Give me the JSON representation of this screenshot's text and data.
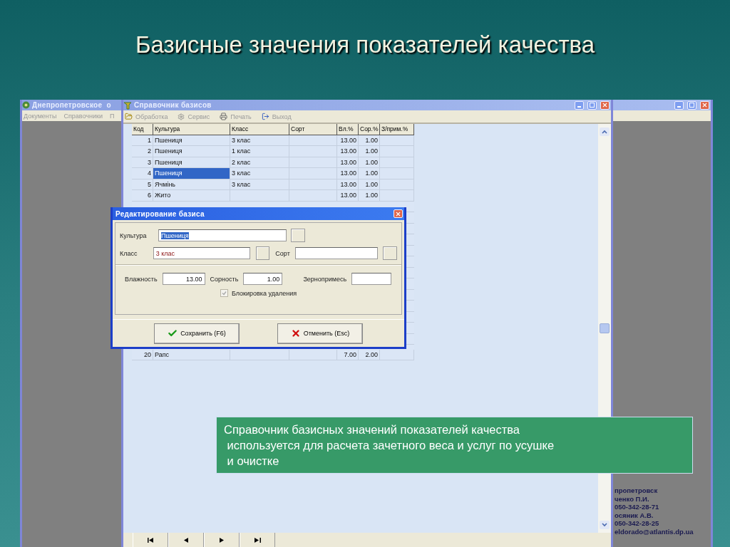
{
  "slide": {
    "title": "Базисные значения показателей качества"
  },
  "main_window": {
    "title": "Днепропетровское  о",
    "menu": [
      "Документы",
      "Справочники",
      "П"
    ],
    "info_lines": [
      "пропетровск",
      "ченко П.И.",
      "050-342-28-71",
      "осяник А.В.",
      "050-342-28-25",
      "eldorado@atlantis.dp.ua"
    ]
  },
  "window": {
    "title": "Справочник базисов",
    "toolbar": [
      {
        "label": "Обработка",
        "disabled": true
      },
      {
        "label": "Сервис",
        "disabled": true
      },
      {
        "label": "Печать",
        "disabled": true
      },
      {
        "label": "Выход",
        "disabled": true
      }
    ],
    "table": {
      "columns": [
        "Код",
        "Культура",
        "Класс",
        "Сорт",
        "Вл.%",
        "Сор.%",
        "З/прим.%"
      ],
      "rows": [
        {
          "cells": [
            "1",
            "Пшениця",
            "3 клас",
            "",
            "13.00",
            "1.00",
            ""
          ],
          "selected": false
        },
        {
          "cells": [
            "2",
            "Пшениця",
            "1 клас",
            "",
            "13.00",
            "1.00",
            ""
          ],
          "selected": false
        },
        {
          "cells": [
            "3",
            "Пшениця",
            "2 клас",
            "",
            "13.00",
            "1.00",
            ""
          ],
          "selected": false
        },
        {
          "cells": [
            "4",
            "Пшениця",
            "3 клас",
            "",
            "13.00",
            "1.00",
            ""
          ],
          "selected": true
        },
        {
          "cells": [
            "5",
            "Ячмінь",
            "3 клас",
            "",
            "13.00",
            "1.00",
            ""
          ],
          "selected": false
        },
        {
          "cells": [
            "6",
            "Жито",
            "",
            "",
            "13.00",
            "1.00",
            ""
          ],
          "selected": false
        }
      ],
      "rows_below_dialog": [
        {
          "cells": [
            "20",
            "Рапс",
            "",
            "",
            "7.00",
            "2.00",
            ""
          ],
          "selected": false
        }
      ]
    }
  },
  "dialog": {
    "title": "Редактирование базиса",
    "culture": {
      "label": "Культура",
      "value": "Пшениця",
      "value_selected": true
    },
    "class": {
      "label": "Класс",
      "value": "3 клас"
    },
    "sort": {
      "label": "Сорт"
    },
    "moisture": {
      "label": "Влажность",
      "value": "13.00"
    },
    "weeds": {
      "label": "Сорность",
      "value": "1.00"
    },
    "admixture": {
      "label": "Зернопримесь"
    },
    "checkbox": {
      "label": "Блокировка удаления",
      "checked": true,
      "disabled": true
    },
    "buttons": [
      {
        "label": "Сохранить (F6)"
      },
      {
        "label": "Отменить (Esc)"
      }
    ]
  },
  "note": {
    "text": "Справочник базисных значений показателей качества\n используется для расчета зачетного веса и услуг по усушке\n и очистке"
  }
}
